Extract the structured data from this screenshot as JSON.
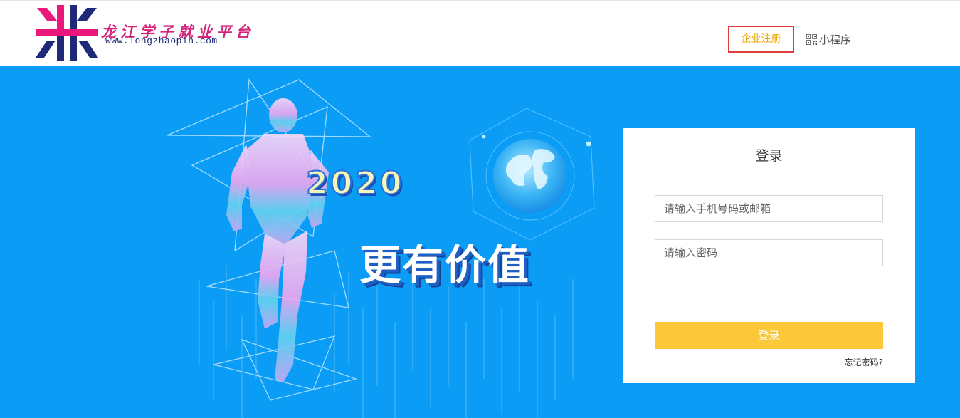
{
  "header": {
    "logo_title": "龙江学子就业平台",
    "logo_url": "www.longzhaopin.com",
    "nav": {
      "register_label": "企业注册",
      "mini_program_label": "小程序"
    }
  },
  "hero": {
    "year_text": "2020",
    "slogan_text": "更有价值"
  },
  "login": {
    "title": "登录",
    "phone_placeholder": "请输入手机号码或邮箱",
    "password_placeholder": "请输入密码",
    "submit_label": "登录",
    "forgot_label": "忘记密码?"
  },
  "colors": {
    "hero_background": "#0b9cf6",
    "register_text": "#f0a500",
    "register_border": "#e13b3b",
    "login_button": "#fcc83a",
    "logo_pink": "#d4237a",
    "logo_navy": "#1e2a78"
  },
  "icons": {
    "logo": "logo-mark-icon",
    "mini_program": "qr-code-icon",
    "hero_figure": "runner-figure-icon",
    "hero_globe": "globe-icon"
  }
}
